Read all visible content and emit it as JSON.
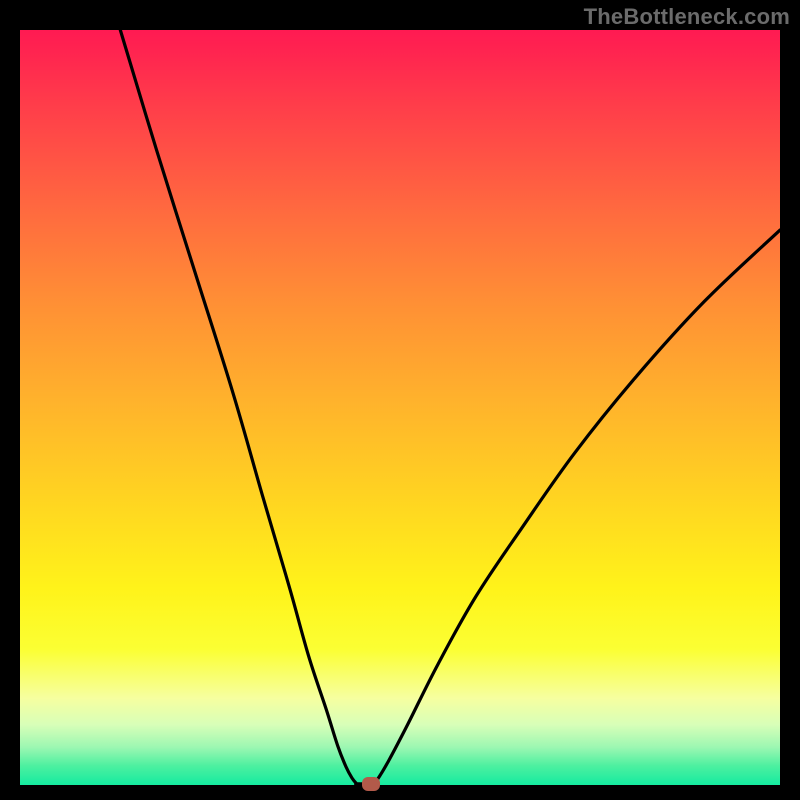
{
  "watermark": "TheBottleneck.com",
  "colors": {
    "frame": "#000000",
    "curve": "#000000",
    "marker": "#b25a4a",
    "gradient_top": "#ff1a52",
    "gradient_bottom": "#15eba0"
  },
  "chart_data": {
    "type": "line",
    "title": "",
    "xlabel": "",
    "ylabel": "",
    "xlim": [
      0,
      100
    ],
    "ylim": [
      0,
      100
    ],
    "series": [
      {
        "name": "left-branch",
        "x": [
          13.2,
          18,
          23,
          28,
          32,
          35.5,
          38,
          40.3,
          41.8,
          42.9,
          43.7,
          44.3
        ],
        "y": [
          100,
          84,
          68,
          52,
          38,
          26,
          17,
          10,
          5.2,
          2.4,
          0.9,
          0.15
        ]
      },
      {
        "name": "flat-bottom",
        "x": [
          44.3,
          46.2
        ],
        "y": [
          0.15,
          0.15
        ]
      },
      {
        "name": "right-branch",
        "x": [
          46.5,
          47.2,
          48.5,
          51,
          55,
          60,
          66,
          73,
          81,
          90,
          100
        ],
        "y": [
          0.15,
          1.0,
          3.2,
          8,
          16,
          25,
          34,
          44,
          54,
          64,
          73.5
        ]
      }
    ],
    "marker": {
      "x": 46.2,
      "y": 0.15
    },
    "annotations": []
  }
}
